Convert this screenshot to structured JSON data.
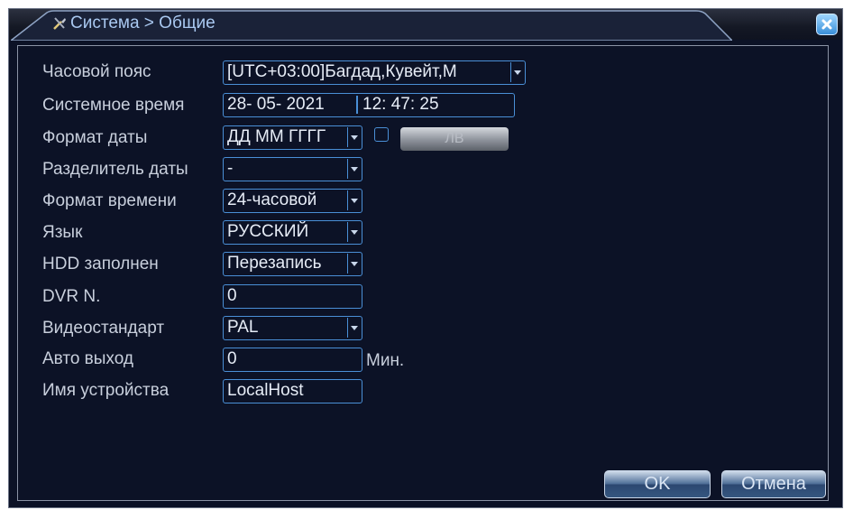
{
  "window": {
    "title": "Система > Общие"
  },
  "settings": {
    "timezone": {
      "label": "Часовой пояс",
      "value": "[UTC+03:00]Багдад,Кувейт,М"
    },
    "system_time": {
      "label": "Системное время",
      "date": "28- 05- 2021",
      "time": "12: 47: 25"
    },
    "date_format": {
      "label": "Формат даты",
      "value": "ДД ММ ГГГГ",
      "dst_button": "ЛВ"
    },
    "date_separator": {
      "label": "Разделитель даты",
      "value": "-"
    },
    "time_format": {
      "label": "Формат времени",
      "value": "24-часовой"
    },
    "language": {
      "label": "Язык",
      "value": "РУССКИЙ"
    },
    "hdd_full": {
      "label": "HDD заполнен",
      "value": "Перезапись"
    },
    "dvr_no": {
      "label": "DVR N.",
      "value": "0"
    },
    "video_standard": {
      "label": "Видеостандарт",
      "value": "PAL"
    },
    "auto_logout": {
      "label": "Авто выход",
      "value": "0",
      "unit": "Мин."
    },
    "device_name": {
      "label": "Имя устройства",
      "value": "LocalHost"
    }
  },
  "footer": {
    "ok_label": "OK",
    "cancel_label": "Отмена"
  },
  "colors": {
    "background": "#0c1226",
    "field_border": "#4a8fd6",
    "label_text": "#c8cfdc"
  }
}
